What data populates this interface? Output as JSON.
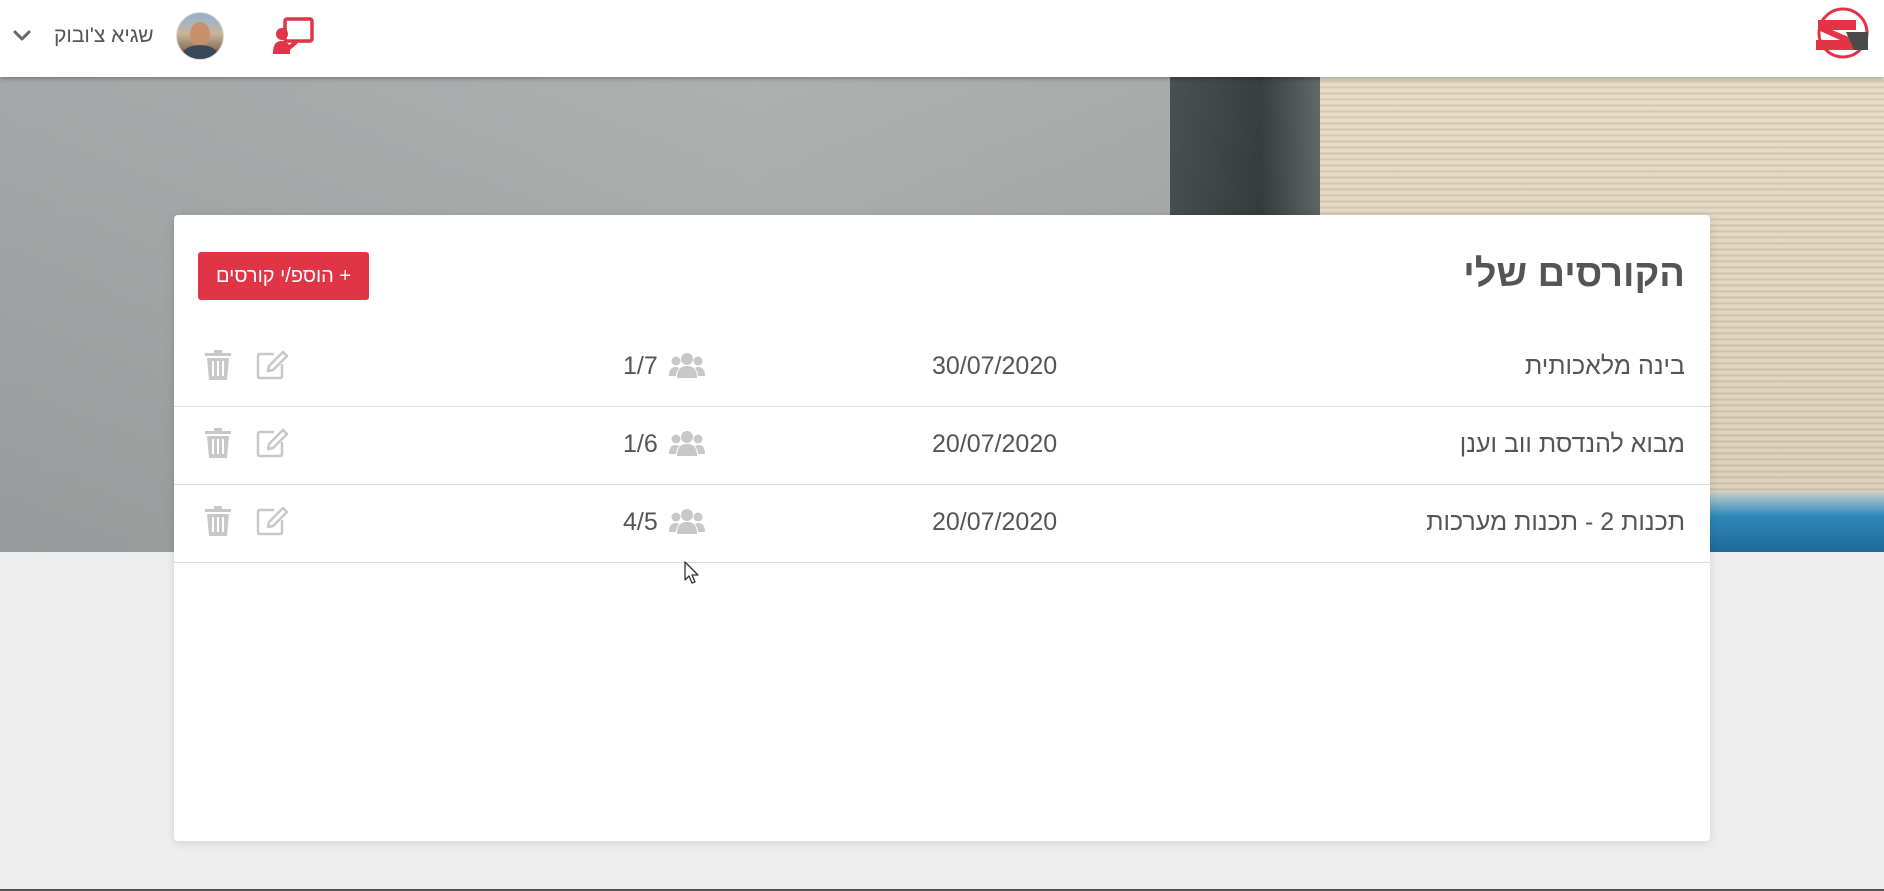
{
  "header": {
    "user_name": "שגיא צ'ובוק",
    "icons": {
      "logo": "brand-logo",
      "teacher": "teacher-board-icon",
      "menu_chevron": "chevron-down-icon",
      "avatar": "user-avatar"
    }
  },
  "main": {
    "title": "הקורסים שלי",
    "add_button_label": "+ הוספ/י קורסים",
    "courses": [
      {
        "name": "בינה מלאכותית",
        "date": "30/07/2020",
        "count": "1/7"
      },
      {
        "name": "מבוא להנדסת ווב וענן",
        "date": "20/07/2020",
        "count": "1/6"
      },
      {
        "name": "תכנות 2 - תכנות מערכות",
        "date": "20/07/2020",
        "count": "4/5"
      }
    ]
  },
  "colors": {
    "accent": "#e03447",
    "text": "#555555",
    "icon_gray": "#c8c8c8",
    "background": "#efeeee"
  }
}
